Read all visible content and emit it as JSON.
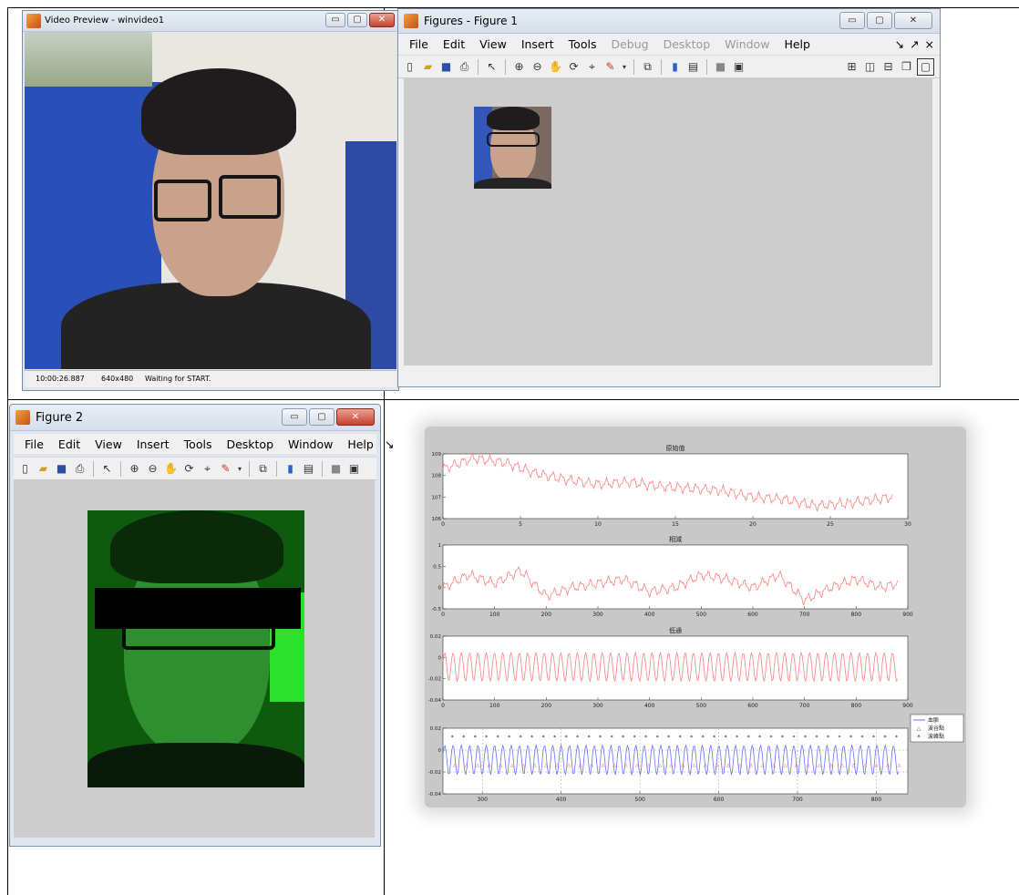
{
  "video_preview": {
    "title": "Video Preview - winvideo1",
    "status": {
      "time": "10:00:26.887",
      "resolution": "640x480",
      "message": "Waiting for START."
    }
  },
  "figure1": {
    "title": "Figures - Figure 1",
    "menu": [
      "File",
      "Edit",
      "View",
      "Insert",
      "Tools",
      "Debug",
      "Desktop",
      "Window",
      "Help"
    ],
    "menu_disabled": [
      "Debug",
      "Desktop",
      "Window"
    ],
    "dock_controls": [
      "↘",
      "↗",
      "×"
    ]
  },
  "figure2": {
    "title": "Figure 2",
    "menu": [
      "File",
      "Edit",
      "View",
      "Insert",
      "Tools",
      "Desktop",
      "Window",
      "Help"
    ],
    "dock_control": "↘"
  },
  "toolbar_icons": [
    "new-file-icon",
    "open-folder-icon",
    "save-icon",
    "print-icon",
    "pointer-icon",
    "zoom-in-icon",
    "zoom-out-icon",
    "pan-icon",
    "rotate-icon",
    "data-cursor-icon",
    "brush-icon",
    "link-plot-icon",
    "colorbar-icon",
    "legend-icon",
    "hide-plot-tools-icon",
    "show-plot-tools-icon"
  ],
  "layout_icons": [
    "tile-icon",
    "left-right-icon",
    "top-bottom-icon",
    "float-icon",
    "maximize-icon"
  ],
  "colors": {
    "plot_red": "#ff8080",
    "plot_blue": "#6a72ff",
    "green_tint": "#1fd41f",
    "matlab_gray": "#cdcdcd"
  },
  "chart_data": [
    {
      "type": "line",
      "title": "原始值",
      "xlim": [
        0,
        30
      ],
      "xticks": [
        0,
        5,
        10,
        15,
        20,
        25,
        30
      ],
      "ylim": [
        106,
        109
      ],
      "yticks": [
        "109",
        "108",
        "107",
        "106"
      ],
      "x": [
        0,
        2,
        4,
        6,
        8,
        10,
        12,
        14,
        16,
        18,
        20,
        22,
        24,
        26,
        28,
        29
      ],
      "y": [
        108.3,
        108.8,
        108.6,
        108.1,
        107.8,
        107.6,
        107.7,
        107.5,
        107.4,
        107.3,
        107.0,
        106.9,
        106.6,
        106.7,
        106.9,
        107.0
      ]
    },
    {
      "type": "line",
      "title": "相減",
      "xlim": [
        0,
        900
      ],
      "xticks": [
        0,
        100,
        200,
        300,
        400,
        500,
        600,
        700,
        800,
        900
      ],
      "ylim": [
        -0.5,
        1
      ],
      "yticks": [
        "1",
        "0.5",
        "0",
        "-0.5"
      ],
      "x": [
        0,
        50,
        100,
        150,
        200,
        250,
        300,
        350,
        400,
        450,
        500,
        550,
        600,
        650,
        700,
        750,
        800,
        850,
        880
      ],
      "y": [
        0.0,
        0.3,
        0.1,
        0.4,
        -0.2,
        0.0,
        0.1,
        0.2,
        -0.1,
        0.0,
        0.3,
        0.2,
        0.0,
        0.3,
        -0.3,
        0.0,
        0.2,
        0.0,
        0.1
      ]
    },
    {
      "type": "line",
      "title": "低通",
      "xlim": [
        0,
        900
      ],
      "xticks": [
        0,
        100,
        200,
        300,
        400,
        500,
        600,
        700,
        800,
        900
      ],
      "ylim": [
        -0.04,
        0.02
      ],
      "yticks": [
        "0.02",
        "0",
        "-0.02",
        "-0.04"
      ],
      "x": [
        0,
        880
      ],
      "y": [
        0.0,
        0.0
      ]
    },
    {
      "type": "line",
      "title": "",
      "xlim": [
        250,
        840
      ],
      "xticks": [
        300,
        400,
        500,
        600,
        700,
        800
      ],
      "ylim": [
        -0.04,
        0.02
      ],
      "yticks": [
        "0.02",
        "0",
        "-0.02",
        "-0.04"
      ],
      "series": [
        {
          "name": "血脈"
        },
        {
          "name": "波谷點"
        },
        {
          "name": "波峰點"
        }
      ]
    }
  ]
}
